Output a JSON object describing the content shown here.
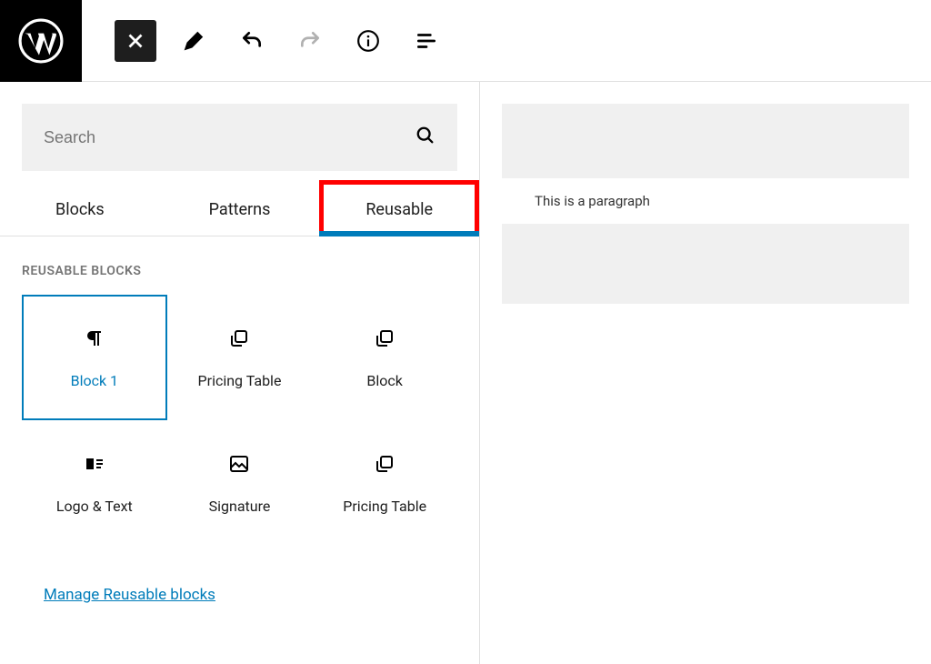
{
  "search": {
    "placeholder": "Search"
  },
  "tabs": {
    "blocks": "Blocks",
    "patterns": "Patterns",
    "reusable": "Reusable"
  },
  "section_title": "REUSABLE BLOCKS",
  "blocks": [
    {
      "label": "Block 1"
    },
    {
      "label": "Pricing Table"
    },
    {
      "label": "Block"
    },
    {
      "label": "Logo & Text"
    },
    {
      "label": "Signature"
    },
    {
      "label": "Pricing Table"
    }
  ],
  "manage_link": "Manage Reusable blocks",
  "preview": {
    "content": "This is a paragraph"
  }
}
